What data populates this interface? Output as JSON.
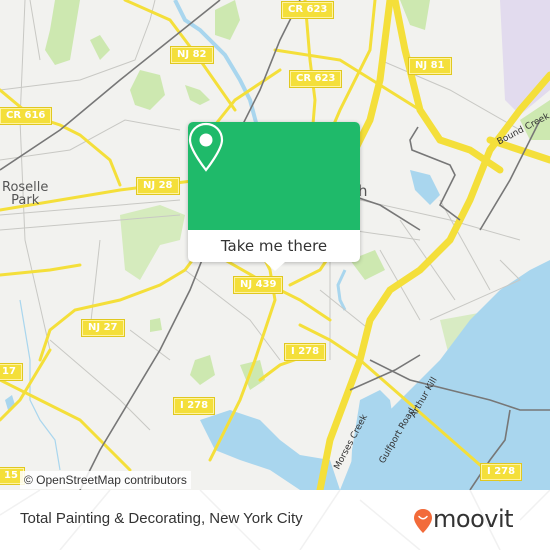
{
  "map": {
    "provider_attribution": "© OpenStreetMap contributors",
    "colors": {
      "land": "#f2f2ef",
      "water": "#a9d6ee",
      "park": "#cde8b0",
      "road_major": "#f4df3a",
      "road_minor": "#c8c8c4",
      "rail": "#777777",
      "airport": "#ddd4ee"
    },
    "place_labels": [
      {
        "id": "roselle-park",
        "text": "Roselle\nPark"
      },
      {
        "id": "elizabeth-partial",
        "text": "h"
      }
    ],
    "road_shields": [
      {
        "id": "cr616",
        "text": "CR 616"
      },
      {
        "id": "nj82",
        "text": "NJ 82"
      },
      {
        "id": "cr623-top",
        "text": "CR 623"
      },
      {
        "id": "cr623",
        "text": "CR 623"
      },
      {
        "id": "nj81",
        "text": "NJ 81"
      },
      {
        "id": "nj28",
        "text": "NJ 28"
      },
      {
        "id": "nj439",
        "text": "NJ 439"
      },
      {
        "id": "nj27",
        "text": "NJ 27"
      },
      {
        "id": "r17",
        "text": "17"
      },
      {
        "id": "i278-a",
        "text": "I 278"
      },
      {
        "id": "i278-b",
        "text": "I 278"
      },
      {
        "id": "i278-c",
        "text": "I 278"
      },
      {
        "id": "r15",
        "text": "15"
      }
    ],
    "water_labels": [
      {
        "id": "bound-creek",
        "text": "Bound Creek"
      },
      {
        "id": "morses-creek",
        "text": "Morses Creek"
      },
      {
        "id": "gulfport-road",
        "text": "Gulfport Road"
      },
      {
        "id": "arthur-kill",
        "text": "Arthur Kill"
      }
    ]
  },
  "popup": {
    "icon": "location-pin-icon",
    "button_label": "Take me there",
    "color": "#1fba6a"
  },
  "footer": {
    "title": "Total Painting & Decorating, New York City",
    "brand": "moovit",
    "brand_color": "#f26b3a"
  }
}
